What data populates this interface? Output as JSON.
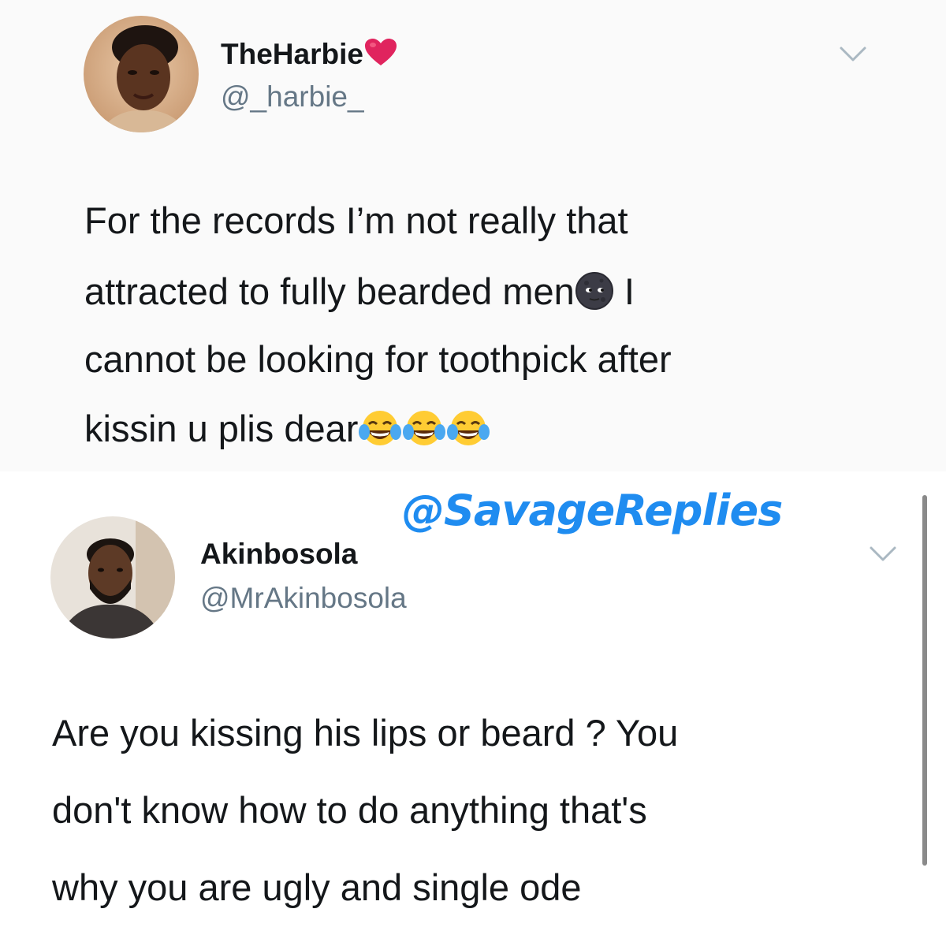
{
  "tweet_1": {
    "display_name": "TheHarbie",
    "handle": "@_harbie_",
    "text_lines": [
      "For the records I’m not really that",
      "attracted to fully bearded men",
      "cannot be looking for toothpick after",
      "kissin u plis dear"
    ],
    "line2_suffix": " I",
    "name_badge_icon": "red-heart-icon",
    "inline_emoji_line2": "new-moon-face-icon",
    "inline_emoji_line4": [
      "tears-of-joy-icon",
      "tears-of-joy-icon",
      "tears-of-joy-icon"
    ]
  },
  "tweet_2": {
    "display_name": "Akinbosola",
    "handle": "@MrAkinbosola",
    "text_lines": [
      "Are you kissing his lips or beard ? You",
      "don't know how to do anything that's",
      "why you are ugly and single ode"
    ]
  },
  "watermark": "@SavageReplies",
  "colors": {
    "watermark": "#1f8cf0",
    "handle": "#657786",
    "text": "#14171a",
    "heart": "#e0245e",
    "tweet1_background": "#fafafa"
  }
}
